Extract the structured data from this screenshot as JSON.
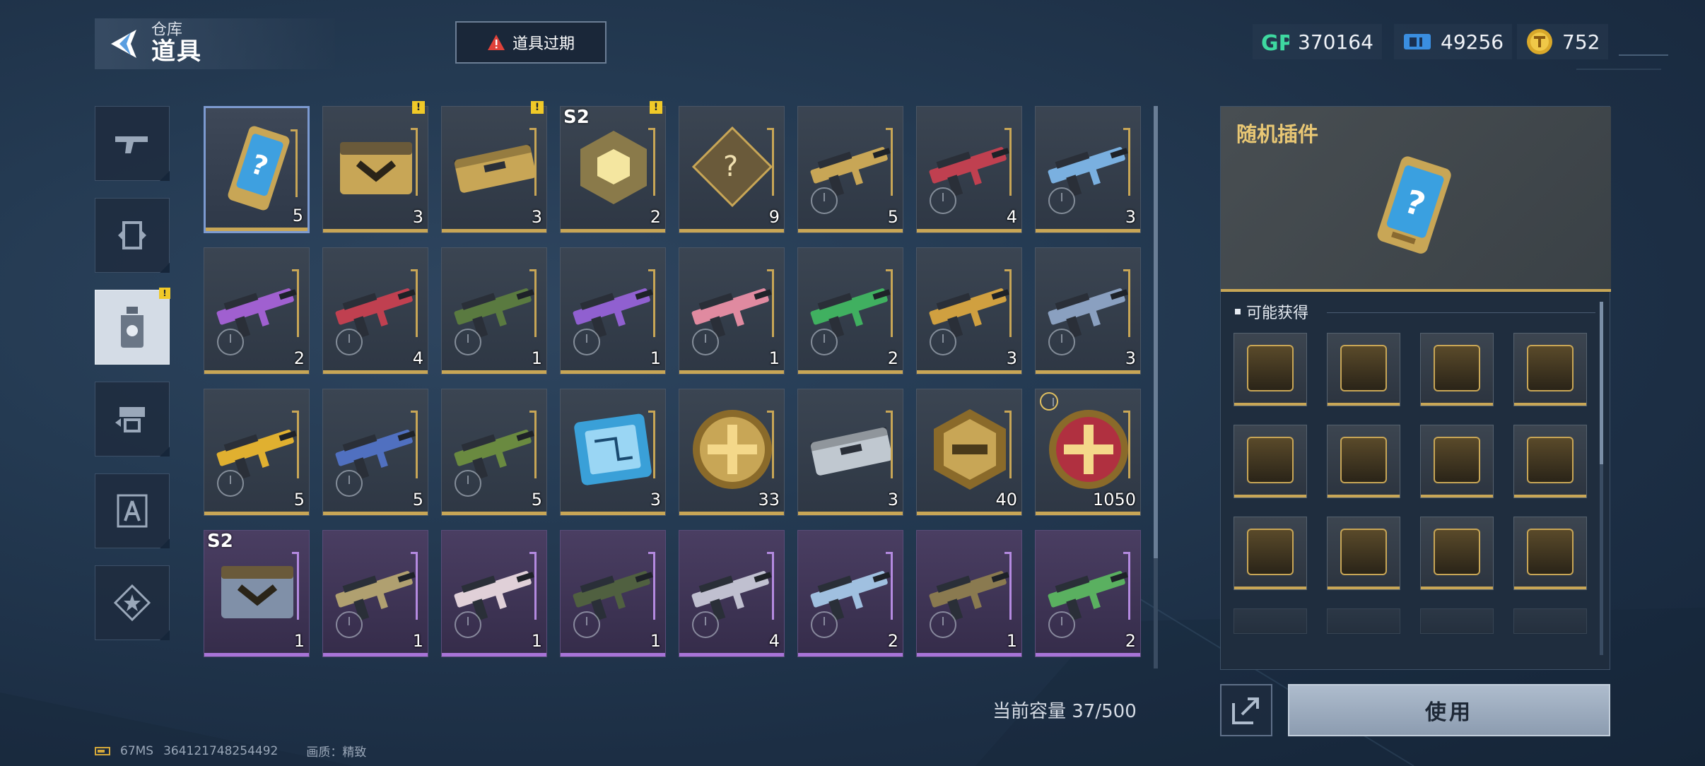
{
  "header": {
    "subtitle": "仓库",
    "title": "道具",
    "expire_button": "道具过期"
  },
  "currencies": [
    {
      "name": "GP",
      "icon": "gp-icon",
      "value": "370164"
    },
    {
      "name": "ticket",
      "icon": "ticket-icon",
      "value": "49256"
    },
    {
      "name": "coin",
      "icon": "coin-icon",
      "value": "752"
    }
  ],
  "sidebar": {
    "tabs": [
      {
        "id": "weapon",
        "icon": "gun-icon",
        "active": false
      },
      {
        "id": "frame",
        "icon": "frame-icon",
        "active": false
      },
      {
        "id": "items",
        "icon": "item-bottle-icon",
        "active": true,
        "alert": true
      },
      {
        "id": "attachment",
        "icon": "attachment-icon",
        "active": false
      },
      {
        "id": "blueprint",
        "icon": "compass-icon",
        "active": false
      },
      {
        "id": "badge",
        "icon": "star-badge-icon",
        "active": false
      }
    ]
  },
  "items": [
    {
      "name": "random-plugin-item",
      "count": "5",
      "color": "#3ea0e0",
      "selected": true,
      "art": "card"
    },
    {
      "name": "supply-crate-item",
      "count": "3",
      "excl": true,
      "color": "#c8a656",
      "art": "crate"
    },
    {
      "name": "gold-case-item",
      "count": "3",
      "excl": true,
      "color": "#c8a656",
      "art": "case"
    },
    {
      "name": "s2-cube-item",
      "count": "2",
      "s2": "S2",
      "excl": true,
      "color": "#c8a656",
      "art": "cube"
    },
    {
      "name": "blueprint-mystery-item",
      "count": "9",
      "color": "#c8a656",
      "art": "blueprint"
    },
    {
      "name": "gold-rifle-item",
      "count": "5",
      "timed": true,
      "color": "#c8a656",
      "art": "gun"
    },
    {
      "name": "red-launcher-item",
      "count": "4",
      "timed": true,
      "color": "#c04050",
      "art": "gun"
    },
    {
      "name": "blue-pistol-item",
      "count": "3",
      "timed": true,
      "color": "#7ab0e0",
      "art": "gun"
    },
    {
      "name": "purple-rifle-item",
      "count": "2",
      "timed": true,
      "color": "#a060d0",
      "art": "gun"
    },
    {
      "name": "sniper-item",
      "count": "4",
      "timed": true,
      "color": "#c04050",
      "art": "gun"
    },
    {
      "name": "camo-rifle-item",
      "count": "1",
      "timed": true,
      "color": "#5a7a40",
      "art": "gun"
    },
    {
      "name": "violet-smg-item",
      "count": "1",
      "timed": true,
      "color": "#9060d0",
      "art": "gun"
    },
    {
      "name": "pink-rifle-item",
      "count": "1",
      "timed": true,
      "color": "#e08aa0",
      "art": "gun"
    },
    {
      "name": "green-launcher-item",
      "count": "2",
      "timed": true,
      "color": "#40b060",
      "art": "gun"
    },
    {
      "name": "gold-shotgun-item",
      "count": "3",
      "timed": true,
      "color": "#d0a040",
      "art": "gun"
    },
    {
      "name": "blade-item",
      "count": "3",
      "timed": true,
      "color": "#8aa0c0",
      "art": "gun"
    },
    {
      "name": "yellow-rifle-item",
      "count": "5",
      "timed": true,
      "color": "#e0b030",
      "art": "gun"
    },
    {
      "name": "blue-sniper-item",
      "count": "5",
      "timed": true,
      "color": "#5070c0",
      "art": "gun"
    },
    {
      "name": "green-pistol-item",
      "count": "5",
      "timed": true,
      "color": "#6a8a40",
      "art": "gun"
    },
    {
      "name": "chip-card-item",
      "count": "3",
      "color": "#3aa0d8",
      "art": "chip"
    },
    {
      "name": "gold-medal-item",
      "count": "33",
      "color": "#c8a656",
      "art": "medal"
    },
    {
      "name": "metal-case-item",
      "count": "3",
      "color": "#c0c8d0",
      "art": "case"
    },
    {
      "name": "gun-badge-item",
      "count": "40",
      "color": "#c8a656",
      "art": "badge"
    },
    {
      "name": "pig-coin-item",
      "count": "1050",
      "clock_top": true,
      "color": "#b03040",
      "art": "medal"
    },
    {
      "name": "character-crate-item",
      "count": "1",
      "s2": "S2",
      "purple": true,
      "color": "#8090a8",
      "art": "crate"
    },
    {
      "name": "purple-rifle-2-item",
      "count": "1",
      "purple": true,
      "timed": true,
      "color": "#b0a070",
      "art": "gun"
    },
    {
      "name": "white-rifle-item",
      "count": "1",
      "purple": true,
      "timed": true,
      "color": "#e0d0d8",
      "art": "gun"
    },
    {
      "name": "dark-rifle-item",
      "count": "1",
      "purple": true,
      "timed": true,
      "color": "#506040",
      "art": "gun"
    },
    {
      "name": "crossbow-item",
      "count": "4",
      "purple": true,
      "timed": true,
      "color": "#c0c0d0",
      "art": "gun"
    },
    {
      "name": "blue-crossbow-item",
      "count": "2",
      "purple": true,
      "timed": true,
      "color": "#a0c0e0",
      "art": "gun"
    },
    {
      "name": "bronze-rifle-item",
      "count": "1",
      "purple": true,
      "timed": true,
      "color": "#8a7a50",
      "art": "gun"
    },
    {
      "name": "green-smg-item",
      "count": "2",
      "purple": true,
      "timed": true,
      "color": "#5ab060",
      "art": "gun"
    }
  ],
  "capacity_label": "当前容量 37/500",
  "detail": {
    "title": "随机插件",
    "section_title": "可能获得",
    "rewards": [
      {
        "icon": "rocket-plugin-icon"
      },
      {
        "icon": "no-fire-plugin-icon"
      },
      {
        "icon": "ammo-up-plugin-icon"
      },
      {
        "icon": "scope-plugin-icon"
      },
      {
        "icon": "ammo-warning-plugin-icon"
      },
      {
        "icon": "target-plugin-icon"
      },
      {
        "icon": "bullets-plugin-icon"
      },
      {
        "icon": "gun-speed-plugin-icon"
      },
      {
        "icon": "shield-plugin-icon"
      },
      {
        "icon": "stats-up-plugin-icon"
      },
      {
        "icon": "crosshair-plugin-icon"
      },
      {
        "icon": "wing-plugin-icon"
      }
    ],
    "use_button": "使用"
  },
  "footer": {
    "latency": "67MS",
    "user_id": "364121748254492",
    "quality": "画质：精致"
  }
}
